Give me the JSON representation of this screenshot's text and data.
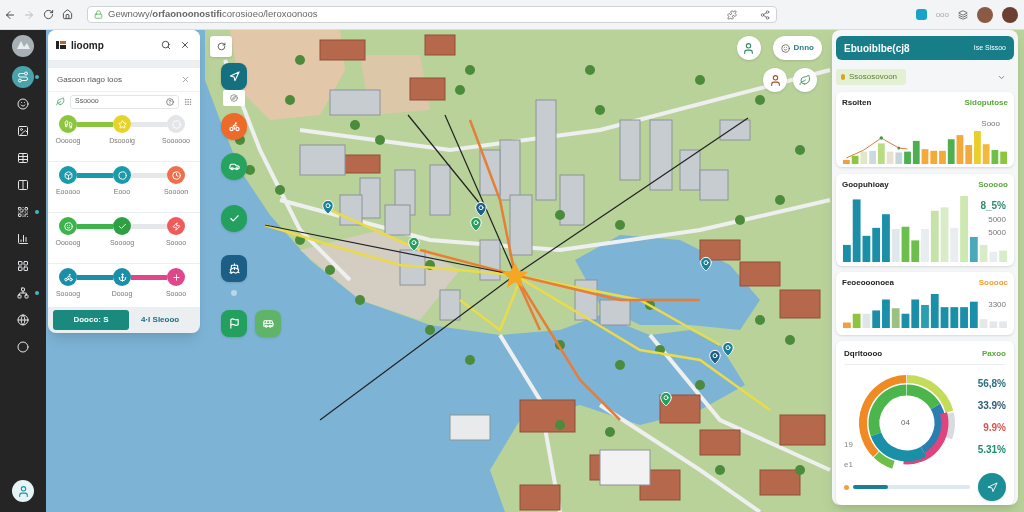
{
  "browser": {
    "back_disabled": false,
    "forward_disabled": true,
    "url": "Gewnowy/**orfaonoonostifi**corosioeo/leroxoonoos",
    "toolbar_label": "ooo"
  },
  "sidebar": {
    "items": [
      {
        "selected": true,
        "unread": true
      },
      {
        "selected": false,
        "unread": false
      },
      {
        "selected": false,
        "unread": false
      },
      {
        "selected": false,
        "unread": false
      },
      {
        "selected": false,
        "unread": false
      },
      {
        "selected": false,
        "unread": true
      },
      {
        "selected": false,
        "unread": false
      },
      {
        "selected": false,
        "unread": false
      },
      {
        "selected": false,
        "unread": true
      },
      {
        "selected": false,
        "unread": false
      },
      {
        "selected": false,
        "unread": false
      }
    ]
  },
  "route_panel": {
    "title": "Iioomp",
    "filter": {
      "title": "Gasoon riago loos",
      "search_value": "Ssoooo"
    },
    "routes": [
      {
        "nodes": [
          {
            "label": "Ooooog",
            "color": "#8cc63f"
          },
          {
            "label": "Dsoooig",
            "color": "#e6d42a"
          },
          {
            "label": "Soooooo",
            "color": "#e3e5e8"
          }
        ],
        "segments": [
          {
            "color": "#8cc63f"
          },
          {
            "color": "#e5e7eb"
          }
        ]
      },
      {
        "nodes": [
          {
            "label": "Eooooo",
            "color": "#1b9aaa"
          },
          {
            "label": "Eooo",
            "color": "#1b9aaa"
          },
          {
            "label": "Soooon",
            "color": "#ef6f4c"
          }
        ],
        "segments": [
          {
            "color": "#1b9aaa"
          },
          {
            "color": "#e5e7eb"
          }
        ]
      },
      {
        "nodes": [
          {
            "label": "Ooooog",
            "color": "#3cb44b"
          },
          {
            "label": "Soooog",
            "color": "#2ea043"
          },
          {
            "label": "Soooo",
            "color": "#ef5b5b"
          }
        ],
        "segments": [
          {
            "color": "#3cb44b"
          },
          {
            "color": "#e5e7eb"
          }
        ]
      },
      {
        "nodes": [
          {
            "label": "Soooog",
            "color": "#1b8fa8"
          },
          {
            "label": "Dooog",
            "color": "#1b8fa8"
          },
          {
            "label": "Soooo",
            "color": "#e0478a"
          }
        ],
        "segments": [
          {
            "color": "#1b8fa8"
          },
          {
            "color": "#e0478a"
          }
        ]
      }
    ],
    "buttons": [
      {
        "label": "Dooco: S",
        "kind": "primary"
      },
      {
        "label": "4·I Sleooo",
        "kind": "link"
      }
    ]
  },
  "map": {
    "tools": [
      {
        "kind": "square",
        "color": "#14707f"
      },
      {
        "kind": "round",
        "color": "#ee6a2b"
      },
      {
        "kind": "round",
        "color": "#27a35f"
      },
      {
        "kind": "round",
        "color": "#23a05e"
      },
      {
        "kind": "square",
        "color": "#1b5f86"
      },
      {
        "kind": "square",
        "color": "#23a05e"
      },
      {
        "kind": "square",
        "color": "#5fb46a"
      }
    ],
    "chip": "Dnno"
  },
  "stats_panel": {
    "title": "Ebuoiblbe(cj8",
    "action": "Ise Sissoo",
    "filter_chip": "Ssososovoon",
    "cards": [
      {
        "kind": "bars",
        "title": "Rsoiten",
        "tag": "Sidoputose",
        "color": "#5aa83a",
        "readouts": [
          {
            "text": "Sooo",
            "kind": "small"
          }
        ]
      },
      {
        "kind": "bars",
        "title": "Goopuhioay",
        "tag": "Sooooo",
        "color": "#5aa83a",
        "readouts": [
          {
            "text": "8_5%",
            "kind": "big"
          },
          {
            "text": "5000",
            "kind": "small"
          },
          {
            "text": "5000",
            "kind": "small"
          }
        ]
      },
      {
        "kind": "bars",
        "title": "Feoeooonoea",
        "tag": "Sooooc",
        "color": "#f0a030",
        "readouts": [
          {
            "text": "3300",
            "kind": "small"
          }
        ]
      },
      {
        "kind": "donut",
        "title": "Dqrltoooo",
        "tag": "Paxoo",
        "color": "#5aa83a",
        "center": "04",
        "legend": [
          {
            "text": "56,8%",
            "color": "#2b6f80"
          },
          {
            "text": "33.9%",
            "color": "#2b5f78"
          },
          {
            "text": "9.9%",
            "color": "#d9534f"
          },
          {
            "text": "5.31%",
            "color": "#1f8a70"
          }
        ],
        "notes": [
          "19",
          "e1"
        ],
        "progress": {
          "level": 0.3
        }
      }
    ]
  }
}
